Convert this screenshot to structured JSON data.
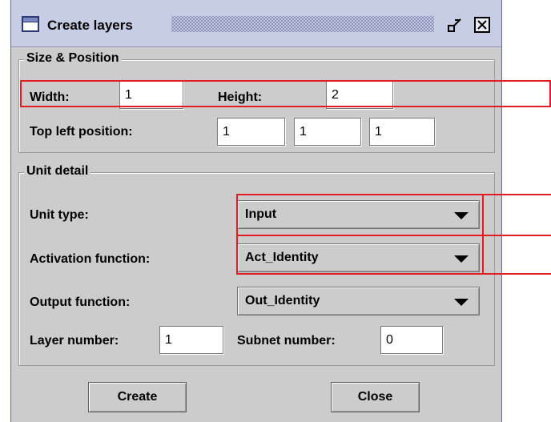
{
  "window": {
    "title": "Create layers",
    "icons": {
      "window": "window-icon",
      "minimize": "minimize-icon",
      "close": "close-icon"
    }
  },
  "size_position": {
    "group_title": "Size & Position",
    "width_label": "Width:",
    "width_value": "1",
    "height_label": "Height:",
    "height_value": "2",
    "top_left_label": "Top left position:",
    "top_left_values": [
      "1",
      "1",
      "1"
    ]
  },
  "unit_detail": {
    "group_title": "Unit detail",
    "unit_type_label": "Unit type:",
    "unit_type_value": "Input",
    "activation_label": "Activation function:",
    "activation_value": "Act_Identity",
    "output_label": "Output function:",
    "output_value": "Out_Identity",
    "layer_number_label": "Layer number:",
    "layer_number_value": "1",
    "subnet_number_label": "Subnet number:",
    "subnet_number_value": "0"
  },
  "buttons": {
    "create": "Create",
    "close": "Close"
  },
  "colors": {
    "annotation": "#e31c23",
    "titlebar": "#c8cde6",
    "panel": "#cccccc"
  }
}
